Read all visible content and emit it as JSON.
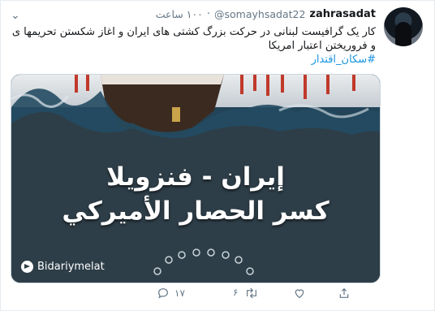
{
  "tweet": {
    "display_name": "zahrasadat",
    "handle": "@somayhsadat22",
    "time_ago": "۱۰۰ ساعت",
    "text_line1": "کار یک گرافیست لبنانی در حرکت بزرگ کشتی های ایران و اغاز شکستن تحریمها ی",
    "text_line2": "و فروریختن اعتبار امریکا",
    "hashtag": "#سکان_اقتدار"
  },
  "media": {
    "overlay_line1": "إيران - فنزويلا",
    "overlay_line2": "كسر الحصار الأميركي",
    "watermark": "Bidariymelat"
  },
  "actions": {
    "reply_count": "۱۷",
    "retweet_count": "۶",
    "like_count": ""
  },
  "icons": {
    "reply": "reply-icon",
    "retweet": "retweet-icon",
    "like": "heart-icon",
    "share": "share-icon",
    "more": "chevron-down-icon"
  },
  "colors": {
    "link": "#1b95e0",
    "muted": "#657786",
    "text": "#14171a"
  }
}
